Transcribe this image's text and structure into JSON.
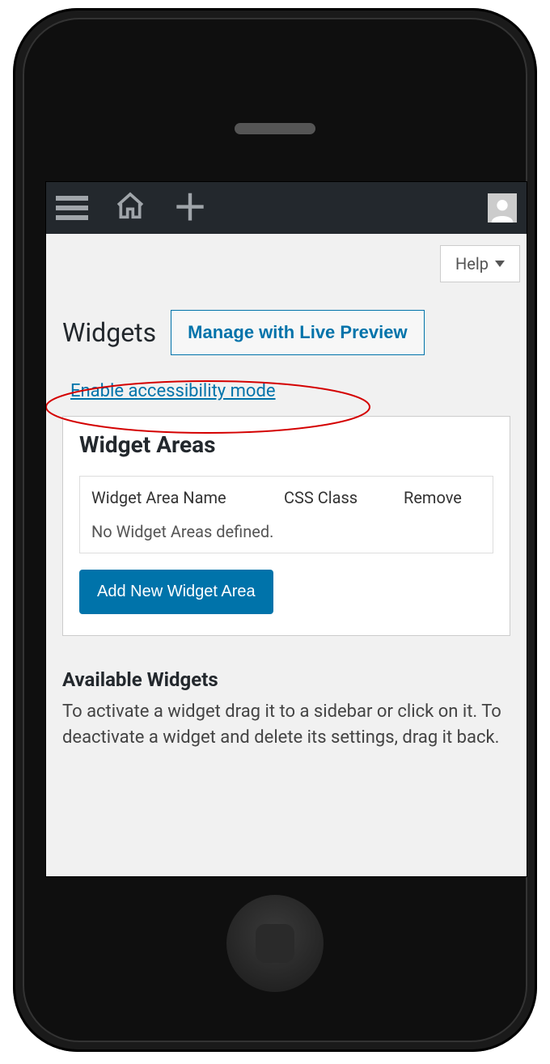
{
  "toolbar": {
    "help_label": "Help"
  },
  "page": {
    "title": "Widgets",
    "manage_button": "Manage with Live Preview",
    "accessibility_link": "Enable accessibility mode"
  },
  "widget_areas": {
    "heading": "Widget Areas",
    "columns": {
      "name": "Widget Area Name",
      "css": "CSS Class",
      "remove": "Remove"
    },
    "empty_msg": "No Widget Areas defined.",
    "add_button": "Add New Widget Area"
  },
  "available": {
    "heading": "Available Widgets",
    "description": "To activate a widget drag it to a sidebar or click on it. To deactivate a widget and delete its settings, drag it back."
  }
}
